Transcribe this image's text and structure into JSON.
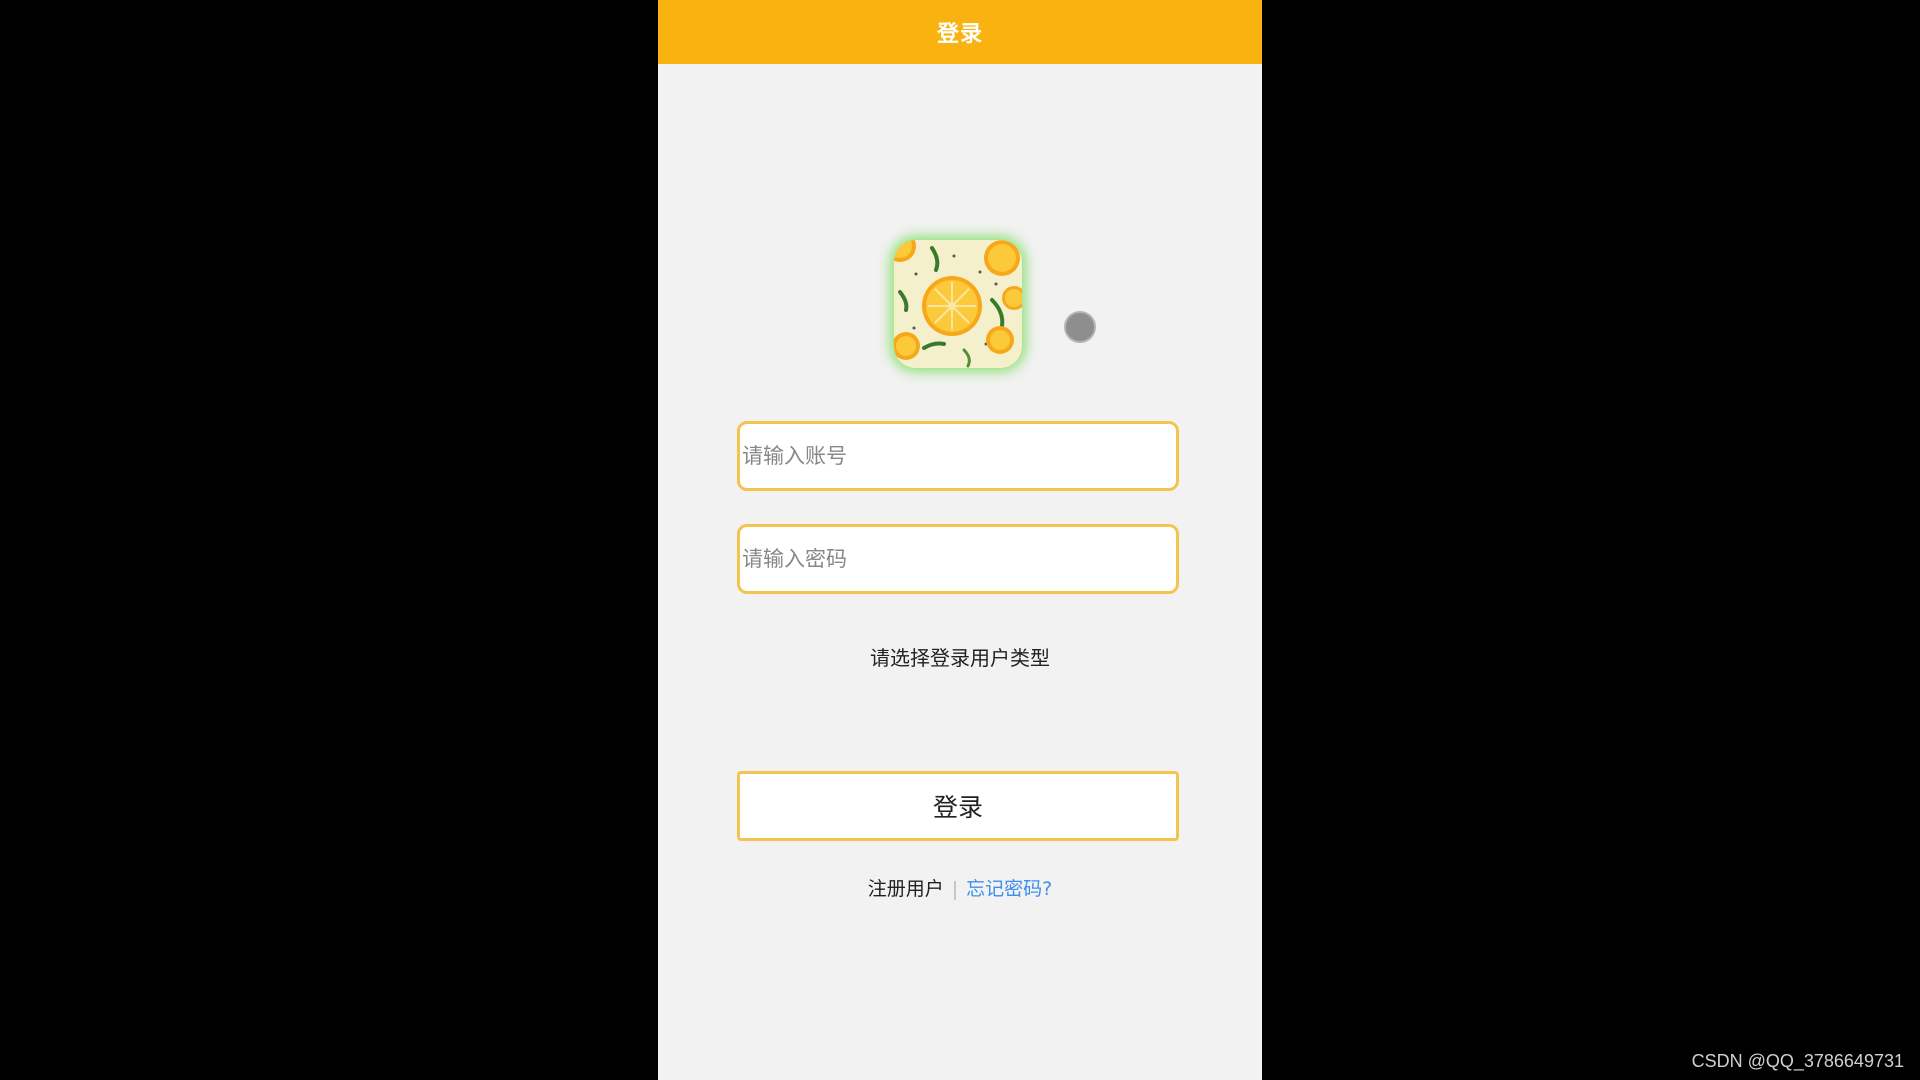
{
  "header": {
    "title": "登录"
  },
  "form": {
    "account_placeholder": "请输入账号",
    "password_placeholder": "请输入密码",
    "user_type_prompt": "请选择登录用户类型",
    "login_label": "登录"
  },
  "links": {
    "register": "注册用户",
    "separator": "|",
    "forgot": "忘记密码?"
  },
  "watermark": "CSDN @QQ_3786649731",
  "colors": {
    "header": "#f8b311",
    "field_border": "#f3c44f",
    "link": "#3d8ef0",
    "background": "#f2f2f2"
  },
  "icons": {
    "avatar": "lemon-avatar-icon",
    "dot": "floating-dot-icon"
  }
}
